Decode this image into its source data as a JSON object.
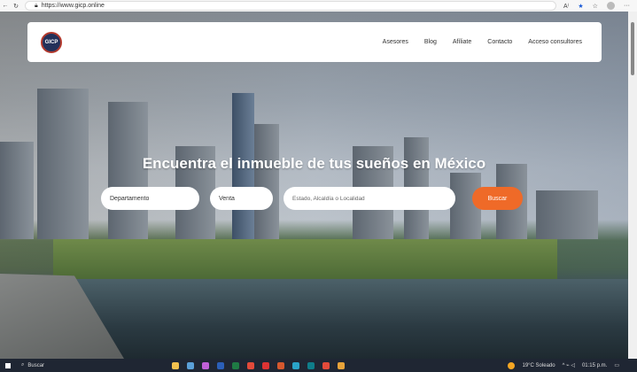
{
  "browser": {
    "url": "https://www.gicp.online"
  },
  "header": {
    "logo_text": "GICP",
    "menu": [
      "Asesores",
      "Blog",
      "Afíliate",
      "Contacto",
      "Acceso consultores"
    ]
  },
  "hero": {
    "title": "Encuentra el inmueble de tus sueños en México",
    "property_type": "Departamento",
    "operation": "Venta",
    "location_placeholder": "Estado, Alcaldía o Localidad",
    "search_button": "Buscar"
  },
  "taskbar": {
    "search_label": "Buscar",
    "weather": "19°C Soleado",
    "time": "01:15 p.m."
  },
  "colors": {
    "accent": "#ef6a28"
  }
}
